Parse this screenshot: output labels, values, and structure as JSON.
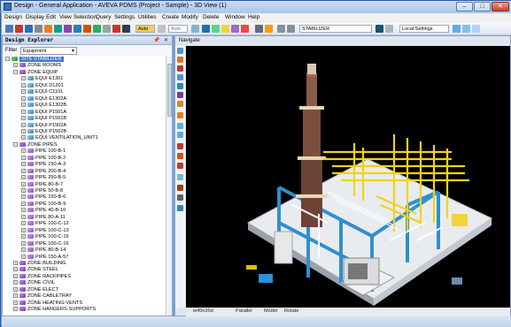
{
  "window": {
    "title": "Design - General Application - AVEVA PDMS (Project - Sample) - 3D View (1)",
    "controls": {
      "minimize": "–",
      "maximize": "□",
      "close": "✕"
    }
  },
  "menu": {
    "items": [
      "Design",
      "Display",
      "Edit",
      "View",
      "Selection",
      "Query",
      "Settings",
      "Utilities",
      "Create",
      "Modify",
      "Delete",
      "Window",
      "Help"
    ]
  },
  "toolbar": {
    "auto_label": "Auto",
    "auto2_label": "Auto",
    "current_element": "STABILIZER",
    "settings": "Local Settings"
  },
  "explorer": {
    "title": "Design Explorer",
    "filter_label": "Filter",
    "filter_value": "Equipment",
    "pin": "📌",
    "close": "✕"
  },
  "tree": [
    {
      "label": "SITE STABILIZER",
      "level": 0,
      "type": "site",
      "expanded": true,
      "selected": true
    },
    {
      "label": "ZONE ROOMS",
      "level": 1,
      "type": "zone",
      "expanded": false
    },
    {
      "label": "ZONE EQUIP",
      "level": 1,
      "type": "zone",
      "expanded": true
    },
    {
      "label": "EQUI E1301",
      "level": 2,
      "type": "equi"
    },
    {
      "label": "EQUI D1201",
      "level": 2,
      "type": "equi"
    },
    {
      "label": "EQUI C1101",
      "level": 2,
      "type": "equi"
    },
    {
      "label": "EQUI E1302A",
      "level": 2,
      "type": "equi"
    },
    {
      "label": "EQUI E1302B",
      "level": 2,
      "type": "equi"
    },
    {
      "label": "EQUI P1501A",
      "level": 2,
      "type": "equi"
    },
    {
      "label": "EQUI P1501B",
      "level": 2,
      "type": "equi"
    },
    {
      "label": "EQUI P1502A",
      "level": 2,
      "type": "equi"
    },
    {
      "label": "EQUI P1502B",
      "level": 2,
      "type": "equi"
    },
    {
      "label": "EQUI VENTILATION_UNIT1",
      "level": 2,
      "type": "equi"
    },
    {
      "label": "ZONE PIPES",
      "level": 1,
      "type": "zone",
      "expanded": true
    },
    {
      "label": "PIPE 100-B-1",
      "level": 2,
      "type": "pipe"
    },
    {
      "label": "PIPE 100-B-2",
      "level": 2,
      "type": "pipe"
    },
    {
      "label": "PIPE 150-A-3",
      "level": 2,
      "type": "pipe"
    },
    {
      "label": "PIPE 200-B-4",
      "level": 2,
      "type": "pipe"
    },
    {
      "label": "PIPE 250-B-5",
      "level": 2,
      "type": "pipe"
    },
    {
      "label": "PIPE 80-B-7",
      "level": 2,
      "type": "pipe"
    },
    {
      "label": "PIPE 50-B-8",
      "level": 2,
      "type": "pipe"
    },
    {
      "label": "PIPE 150-B-6",
      "level": 2,
      "type": "pipe"
    },
    {
      "label": "PIPE 100-B-9",
      "level": 2,
      "type": "pipe"
    },
    {
      "label": "PIPE 40-B-10",
      "level": 2,
      "type": "pipe"
    },
    {
      "label": "PIPE 80-A-11",
      "level": 2,
      "type": "pipe"
    },
    {
      "label": "PIPE 100-C-12",
      "level": 2,
      "type": "pipe"
    },
    {
      "label": "PIPE 100-C-13",
      "level": 2,
      "type": "pipe"
    },
    {
      "label": "PIPE 100-C-15",
      "level": 2,
      "type": "pipe"
    },
    {
      "label": "PIPE 100-C-16",
      "level": 2,
      "type": "pipe"
    },
    {
      "label": "PIPE 80-B-14",
      "level": 2,
      "type": "pipe"
    },
    {
      "label": "PIPE 150-A-57",
      "level": 2,
      "type": "pipe"
    },
    {
      "label": "ZONE BUILDING",
      "level": 1,
      "type": "zone"
    },
    {
      "label": "ZONE STEEL",
      "level": 1,
      "type": "zone"
    },
    {
      "label": "ZONE RACKPIPES",
      "level": 1,
      "type": "zone"
    },
    {
      "label": "ZONE CIVIL",
      "level": 1,
      "type": "zone"
    },
    {
      "label": "ZONE ELECT",
      "level": 1,
      "type": "zone"
    },
    {
      "label": "ZONE CABLETRAY",
      "level": 1,
      "type": "zone"
    },
    {
      "label": "ZONE HEATING-VENTS",
      "level": 1,
      "type": "zone"
    },
    {
      "label": "ZONE HANGERS-SUPPORTS",
      "level": 1,
      "type": "zone"
    }
  ],
  "viewport": {
    "nav_label": "Navigate",
    "status": {
      "view_code": "w45n35d",
      "projection": "Parallel",
      "mode": "Model",
      "action": "Rotate"
    }
  }
}
